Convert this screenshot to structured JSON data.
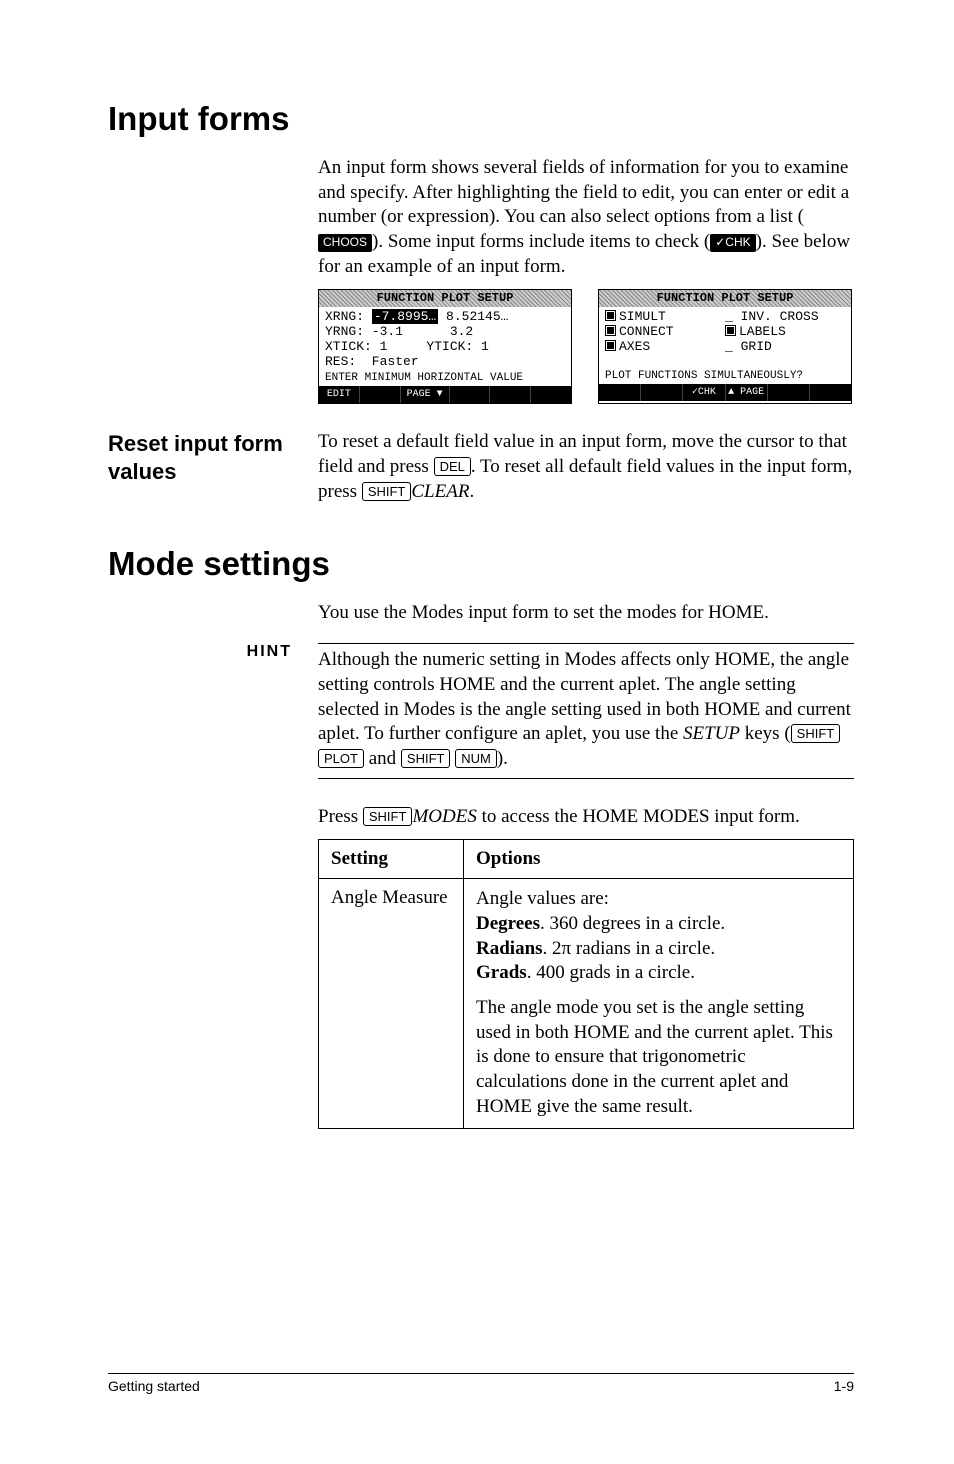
{
  "h1_input_forms": "Input forms",
  "intro_p1_a": "An input form shows several fields of information for you to examine and specify. After highlighting the field to edit, you can enter or edit a number (or expression). You can also select options from a list (",
  "intro_p1_b": "). Some input forms include items to check (",
  "intro_p1_c": "). See below for an example of an input form.",
  "softkey_choos": "CHOOS",
  "softkey_chk": "✓CHK",
  "lcd1": {
    "title": "FUNCTION PLOT SETUP",
    "l1a": "XRNG: ",
    "l1b": "-7.8995…",
    "l1c": " 8.52145…",
    "l2": "YRNG: -3.1      3.2",
    "l3": "XTICK: 1     YTICK: 1",
    "l4": "RES:  Faster",
    "prompt": "ENTER MINIMUM HORIZONTAL VALUE",
    "sk": [
      "EDIT",
      " ",
      " PAGE ▼ ",
      " ",
      " ",
      " "
    ]
  },
  "lcd2": {
    "title": "FUNCTION PLOT SETUP",
    "c1": "SIMULT",
    "c2": "CONNECT",
    "c3": "AXES",
    "c4": "INV. CROSS",
    "c5": "LABELS",
    "c6": "GRID",
    "prompt": "PLOT FUNCTIONS SIMULTANEOUSLY?",
    "sk": [
      " ",
      " ",
      "✓CHK",
      "▲ PAGE",
      " ",
      " "
    ]
  },
  "reset_heading": "Reset input form values",
  "reset_p_a": "To reset a default field value in an input form, move the cursor to that field and press ",
  "key_del": "DEL",
  "reset_p_b": ". To reset all default field values in the input form, press ",
  "key_shift": "SHIFT",
  "key_clear": "CLEAR",
  "reset_p_c": ".",
  "h1_mode": "Mode settings",
  "mode_intro": "You use the Modes input form to set the modes for HOME.",
  "hint_label": "HINT",
  "hint_a": "Although the numeric setting in Modes affects only HOME, the angle setting controls HOME and the current aplet. The angle setting selected in Modes is the angle setting used in both HOME and current aplet. To further configure an aplet, you use the ",
  "hint_setup": "SETUP",
  "hint_b": " keys (",
  "key_plot": "PLOT",
  "hint_and": " and ",
  "key_num": "NUM",
  "hint_c": ").",
  "press_a": "Press ",
  "key_modes": "MODES",
  "press_b": " to access the HOME MODES input form.",
  "th_setting": "Setting",
  "th_options": "Options",
  "td_setting": "Angle Measure",
  "opt_lead": "Angle values are:",
  "opt_deg_b": "Degrees",
  "opt_deg_t": ". 360 degrees in a circle.",
  "opt_rad_b": "Radians",
  "opt_rad_t": ". 2π radians in a circle.",
  "opt_grd_b": "Grads",
  "opt_grd_t": ". 400 grads in a circle.",
  "opt_para": "The angle mode you set is the angle setting used in both HOME and the current aplet. This is done to ensure that trigonometric calculations done in the current aplet and HOME give the same result.",
  "footer_left": "Getting started",
  "footer_right": "1-9"
}
